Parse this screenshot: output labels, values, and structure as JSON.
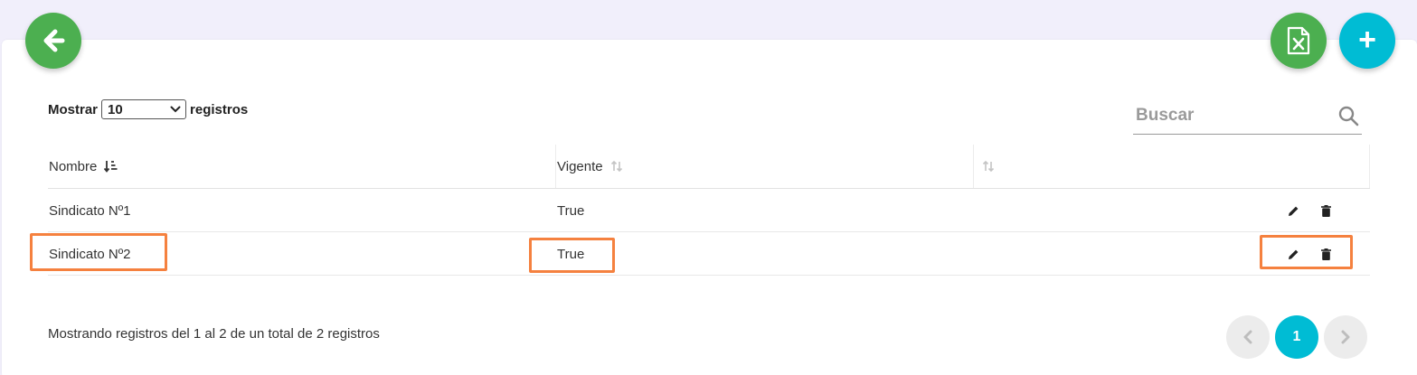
{
  "buttons": {
    "back_icon": "arrow-left-icon",
    "excel_icon": "excel-file-icon",
    "add_label": "+"
  },
  "length_control": {
    "prefix": "Mostrar",
    "selected": "10",
    "suffix": "registros"
  },
  "search": {
    "placeholder": "Buscar"
  },
  "table": {
    "headers": [
      "Nombre",
      "Vigente",
      ""
    ],
    "rows": [
      {
        "nombre": "Sindicato Nº1",
        "vigente": "True"
      },
      {
        "nombre": "Sindicato Nº2",
        "vigente": "True"
      }
    ]
  },
  "footer": {
    "info": "Mostrando registros del 1 al 2 de un total de 2 registros",
    "current_page": "1"
  },
  "colors": {
    "green": "#4caf50",
    "cyan": "#00bcd4",
    "highlight": "#f5813f"
  }
}
